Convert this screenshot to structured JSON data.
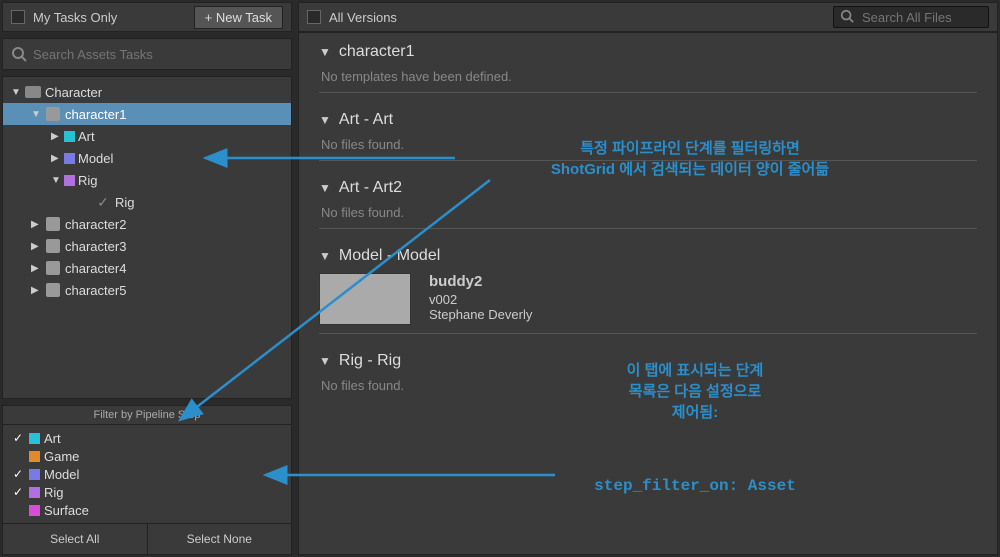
{
  "left": {
    "my_tasks_only": "My Tasks Only",
    "new_task": "+ New Task",
    "search_placeholder": "Search Assets Tasks",
    "tree": {
      "root": "Character",
      "selected": "character1",
      "steps": [
        {
          "name": "Art",
          "color": "#26c3d6"
        },
        {
          "name": "Model",
          "color": "#7a7ae6"
        },
        {
          "name": "Rig",
          "color": "#b070e0"
        }
      ],
      "rig_task": "Rig",
      "siblings": [
        "character2",
        "character3",
        "character4",
        "character5"
      ]
    },
    "filter_header": "Filter by Pipeline Step",
    "filters": [
      {
        "name": "Art",
        "color": "#26c3d6",
        "checked": true
      },
      {
        "name": "Game",
        "color": "#e08a2a",
        "checked": false
      },
      {
        "name": "Model",
        "color": "#7a7ae6",
        "checked": true
      },
      {
        "name": "Rig",
        "color": "#b070e0",
        "checked": true
      },
      {
        "name": "Surface",
        "color": "#d64fd6",
        "checked": false
      }
    ],
    "select_all": "Select All",
    "select_none": "Select None"
  },
  "right": {
    "all_versions": "All Versions",
    "search_placeholder": "Search All Files",
    "sections": [
      {
        "title": "character1",
        "body": "No templates have been defined."
      },
      {
        "title": "Art - Art",
        "body": "No files found."
      },
      {
        "title": "Art - Art2",
        "body": "No files found."
      },
      {
        "title": "Model - Model",
        "body": "",
        "thumb": {
          "title": "buddy2",
          "version": "v002",
          "author": "Stephane Deverly"
        }
      },
      {
        "title": "Rig - Rig",
        "body": "No files found."
      }
    ]
  },
  "annotations": {
    "a1_line1": "특정 파이프라인 단계를 필터링하면",
    "a1_line2": "ShotGrid 에서 검색되는 데이터 양이 줄어듦",
    "a2": "이 탭에 표시되는 단계\n목록은 다음 설정으로\n제어됨:",
    "a3": "step_filter_on: Asset"
  }
}
